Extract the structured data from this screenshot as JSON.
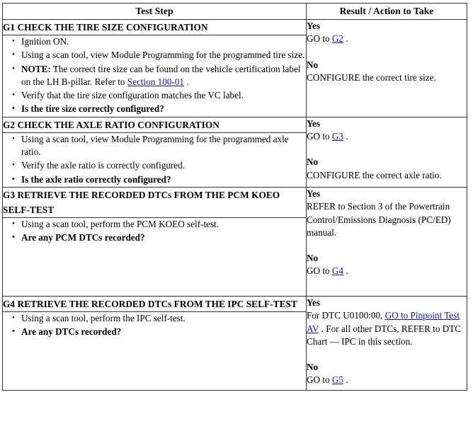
{
  "table": {
    "headers": {
      "test_step": "Test Step",
      "result_action": "Result / Action to Take"
    },
    "link_color": "#1313c6",
    "steps": [
      {
        "id": "G1",
        "title": "G1 CHECK THE TIRE SIZE CONFIGURATION",
        "bullets": [
          {
            "text": "Ignition ON.",
            "bold": false
          },
          {
            "text": "Using a scan tool, view Module Programming for the programmed tire size.",
            "bold": false
          },
          {
            "note_label": "NOTE:",
            "text": " The correct tire size can be found on the vehicle certification label on the LH B-pillar. Refer to ",
            "link": "Section 100-01",
            "after_link": " .",
            "bold": false
          },
          {
            "text": "Verify that the tire size configuration matches the VC label.",
            "bold": false
          },
          {
            "text": "Is the tire size correctly configured?",
            "bold": true
          }
        ],
        "result": {
          "yes_label": "Yes",
          "yes_pre": "GO to ",
          "yes_link": "G2",
          "yes_post": " .",
          "no_label": "No",
          "no_text": "CONFIGURE the correct tire size."
        }
      },
      {
        "id": "G2",
        "title": "G2 CHECK THE AXLE RATIO CONFIGURATION",
        "bullets": [
          {
            "text": "Using a scan tool, view Module Programming for the programmed axle ratio.",
            "bold": false
          },
          {
            "text": "Verify the axle ratio is correctly configured.",
            "bold": false
          },
          {
            "text": "Is the axle ratio correctly configured?",
            "bold": true
          }
        ],
        "result": {
          "yes_label": "Yes",
          "yes_pre": "GO to ",
          "yes_link": "G3",
          "yes_post": " .",
          "no_label": "No",
          "no_text": "CONFIGURE the correct axle ratio."
        }
      },
      {
        "id": "G3",
        "title": "G3 RETRIEVE THE RECORDED DTCs FROM THE PCM KOEO SELF-TEST",
        "bullets": [
          {
            "text": "Using a scan tool, perform the PCM KOEO self-test.",
            "bold": false
          },
          {
            "text": "Are any PCM DTCs recorded?",
            "bold": true
          }
        ],
        "result": {
          "yes_label": "Yes",
          "yes_text": "REFER to Section 3 of the Powertrain Control/Emissions Diagnosis (PC/ED) manual.",
          "no_label": "No",
          "no_pre": "GO to ",
          "no_link": "G4",
          "no_post": " ."
        }
      },
      {
        "id": "G4",
        "title": "G4 RETRIEVE THE RECORDED DTCs FROM THE IPC SELF-TEST",
        "bullets": [
          {
            "text": "Using a scan tool, perform the IPC self-test.",
            "bold": false
          },
          {
            "text": "Are any DTCs recorded?",
            "bold": true
          }
        ],
        "result": {
          "yes_label": "Yes",
          "yes_pre": "For DTC U0100:00, ",
          "yes_link": "GO to Pinpoint Test AV",
          "yes_post": " . For all other DTCs, REFER to DTC Chart — IPC in this section.",
          "no_label": "No",
          "no_pre": "GO to ",
          "no_link": "G5",
          "no_post": " ."
        }
      }
    ]
  }
}
